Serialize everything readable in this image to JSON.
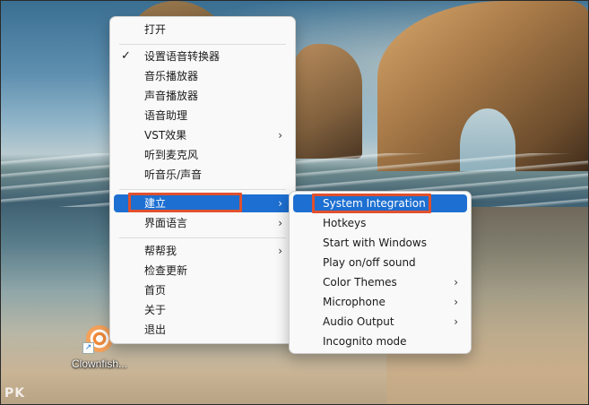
{
  "desktop": {
    "icon_label": "Clownfish...",
    "watermark": "PK"
  },
  "context_menu": {
    "items": [
      {
        "label": "打开"
      },
      {
        "label": "设置语音转换器",
        "checked": true
      },
      {
        "label": "音乐播放器"
      },
      {
        "label": "声音播放器"
      },
      {
        "label": "语音助理"
      },
      {
        "label": "VST效果",
        "submenu": true
      },
      {
        "label": "听到麦克风"
      },
      {
        "label": "听音乐/声音"
      },
      {
        "label": "建立",
        "submenu": true,
        "highlighted": true
      },
      {
        "label": "界面语言",
        "submenu": true
      },
      {
        "label": "帮帮我",
        "submenu": true
      },
      {
        "label": "检查更新"
      },
      {
        "label": "首页"
      },
      {
        "label": "关于"
      },
      {
        "label": "退出"
      }
    ]
  },
  "sub_menu": {
    "items": [
      {
        "label": "System Integration",
        "highlighted": true
      },
      {
        "label": "Hotkeys"
      },
      {
        "label": "Start with Windows"
      },
      {
        "label": "Play on/off sound"
      },
      {
        "label": "Color Themes",
        "submenu": true
      },
      {
        "label": "Microphone",
        "submenu": true
      },
      {
        "label": "Audio Output",
        "submenu": true
      },
      {
        "label": "Incognito mode"
      }
    ]
  },
  "glyphs": {
    "check": "✓",
    "arrow": "›",
    "shortcut": "↗"
  },
  "colors": {
    "highlight": "#1d6fd1",
    "annotation_box": "#e0502d",
    "menu_bg": "#f9f9f9"
  }
}
